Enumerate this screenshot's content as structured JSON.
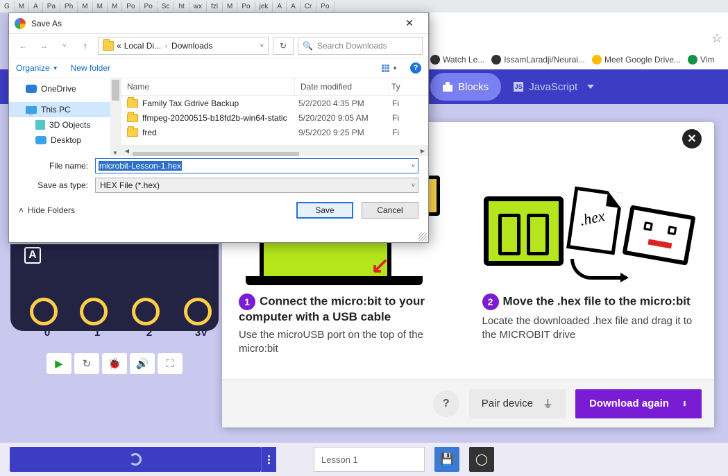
{
  "tabs": [
    "G",
    "M",
    "A",
    "Pa",
    "Ph",
    "M",
    "M",
    "M",
    "Po",
    "Po",
    "Sc",
    "ht",
    "wx",
    "fzl",
    "M",
    "Po",
    "jek",
    "A",
    "A",
    "Cr",
    "Po"
  ],
  "bookmarks": [
    {
      "label": "Watch Le..."
    },
    {
      "label": "IssamLaradji/Neural..."
    },
    {
      "label": "Meet Google Drive..."
    },
    {
      "label": "Vim"
    }
  ],
  "makecode": {
    "blocks": "Blocks",
    "javascript": "JavaScript"
  },
  "modal": {
    "step1_title": "Connect the micro:bit to your computer with a USB cable",
    "step1_body": "Use the microUSB port on the top of the micro:bit",
    "step2_title": "Move the .hex file to the micro:bit",
    "step2_body": "Locate the downloaded .hex file and drag it to the MICROBIT drive",
    "hex_label": ".hex",
    "help": "?",
    "pair": "Pair device",
    "download": "Download again"
  },
  "bottom": {
    "project": "Lesson 1"
  },
  "sim": {
    "pins": [
      "0",
      "1",
      "2",
      "3V"
    ]
  },
  "dialog": {
    "title": "Save As",
    "crumb_prefix": "«",
    "crumb_a": "Local Di...",
    "crumb_b": "Downloads",
    "search_placeholder": "Search Downloads",
    "organize": "Organize",
    "newfolder": "New folder",
    "cols": {
      "name": "Name",
      "date": "Date modified",
      "type": "Ty"
    },
    "tree": [
      {
        "label": "OneDrive",
        "icon": "ic-onedrive"
      },
      {
        "label": "This PC",
        "icon": "ic-pc",
        "sel": true
      },
      {
        "label": "3D Objects",
        "icon": "ic-3d",
        "indent": true
      },
      {
        "label": "Desktop",
        "icon": "ic-onedrive",
        "indent": true
      }
    ],
    "rows": [
      {
        "name": "Family Tax Gdrive Backup",
        "date": "5/2/2020 4:35 PM",
        "type": "Fi"
      },
      {
        "name": "ffmpeg-20200515-b18fd2b-win64-static",
        "date": "5/20/2020 9:05 AM",
        "type": "Fi"
      },
      {
        "name": "fred",
        "date": "9/5/2020 9:25 PM",
        "type": "Fi"
      }
    ],
    "filename_label": "File name:",
    "filename_value": "microbit-Lesson-1.hex",
    "savetype_label": "Save as type:",
    "savetype_value": "HEX File (*.hex)",
    "hide": "Hide Folders",
    "save": "Save",
    "cancel": "Cancel"
  }
}
